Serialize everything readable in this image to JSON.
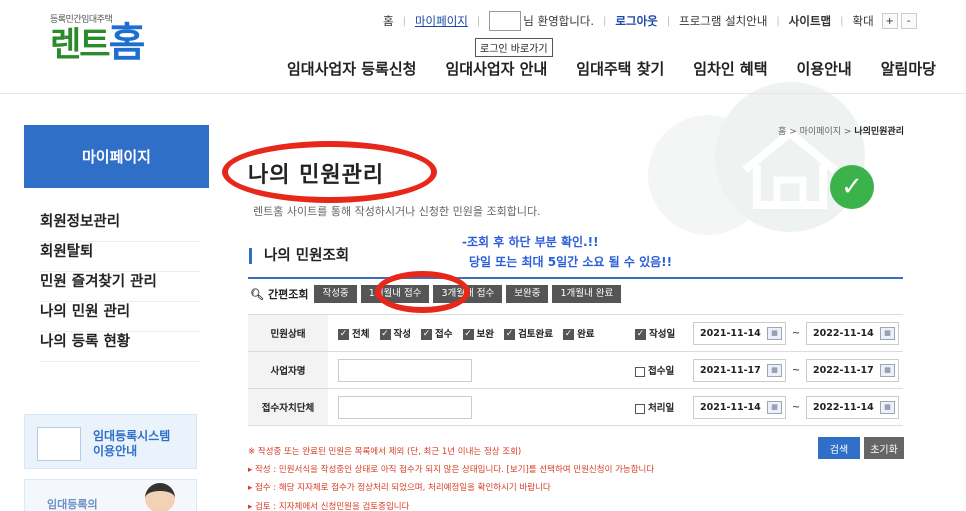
{
  "header": {
    "logo_small": "등록민간임대주택",
    "logo_main_a": "렌트",
    "logo_main_b": "홈",
    "top_links": {
      "home": "홈",
      "mypage": "마이페이지",
      "welcome": "님 환영합니다.",
      "logout": "로그아웃",
      "program": "프로그램 설치안내",
      "sitemap": "사이트맵",
      "zoom": "확대",
      "zoom_in": "+",
      "zoom_out": "-"
    },
    "tooltip": "로그인 바로가기",
    "gnb": [
      "임대사업자 등록신청",
      "임대사업자 안내",
      "임대주택 찾기",
      "임차인 혜택",
      "이용안내",
      "알림마당"
    ]
  },
  "sidebar": {
    "title": "마이페이지",
    "items": [
      "회원정보관리",
      "회원탈퇴",
      "민원 즐겨찾기 관리",
      "나의 민원 관리",
      "나의 등록 현황"
    ],
    "banner1": [
      "임대등록시스템",
      "이용안내"
    ],
    "banner2": "임대등록의"
  },
  "breadcrumb": {
    "home": "홈",
    "sep": ">",
    "parent": "마이페이지",
    "current": "나의민원관리"
  },
  "main": {
    "title": "나의 민원관리",
    "description": "렌트홈 사이트를 통해 작성하시거나 신청한 민원을 조회합니다.",
    "section_title": "나의 민원조회",
    "annotation": [
      "-조회 후 하단 부분 확인.!!",
      "당일 또는 최대 5일간 소요 될 수 있음!!"
    ]
  },
  "quick_search": {
    "label": "간편조회",
    "chips": [
      "작성중",
      "1개월내 접수",
      "3개월내 접수",
      "보완중",
      "1개월내 완료"
    ]
  },
  "form": {
    "status_label": "민원상태",
    "statuses": [
      "전체",
      "작성",
      "접수",
      "보완",
      "검토완료",
      "완료"
    ],
    "business_label": "사업자명",
    "local_label": "접수자치단체",
    "date_rows": [
      {
        "label": "작성일",
        "checked": true,
        "from": "2021-11-14",
        "to": "2022-11-14"
      },
      {
        "label": "접수일",
        "checked": false,
        "from": "2021-11-17",
        "to": "2022-11-17"
      },
      {
        "label": "처리일",
        "checked": false,
        "from": "2021-11-14",
        "to": "2022-11-14"
      }
    ],
    "tilde": "~",
    "search_button": "검색",
    "reset_button": "초기화"
  },
  "notes": [
    "※ 작성중 또는 완료된 민원은 목록에서 제외 (단, 최근 1년 이내는 정상 조회)",
    "▸ 작성 : 민원서식을 작성중인 상태로 아직 접수가 되지 않은 상태입니다. [보기]를 선택하여 민원신청이 가능합니다",
    "▸ 접수 : 해당 지자체로 접수가 정상처리 되었으며, 처리예정일을 확인하시기 바랍니다",
    "▸ 검토 : 지자체에서 신청민원을 검토중입니다"
  ],
  "colors": {
    "brand_blue": "#2f6fc8",
    "brand_green": "#2b8a2b",
    "highlight_red": "#e8271b",
    "annotation_blue": "#2b5fd9"
  }
}
